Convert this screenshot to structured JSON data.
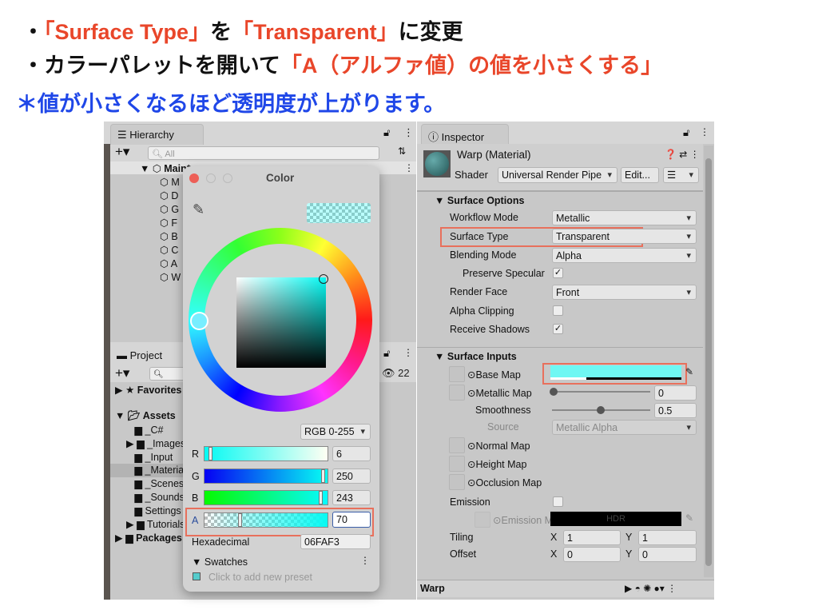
{
  "instructions": {
    "line1": {
      "bullet": "・",
      "p1": "「Surface Type」",
      "p2": "を",
      "p3": "「Transparent」",
      "p4": "に変更"
    },
    "line2": {
      "p1": "・カラーパレットを開いて",
      "p2": "「A（アルファ値）の値を小さくする」"
    },
    "line3": "＊値が小さくなるほど透明度が上がります。"
  },
  "hierarchy": {
    "tab": "Hierarchy",
    "search_placeholder": "All",
    "scene": "Main*",
    "items": [
      "M",
      "D",
      "G",
      "F",
      "B",
      "C",
      "A",
      "W"
    ]
  },
  "project": {
    "tab": "Project",
    "visible_count": "22",
    "favorites": "Favorites",
    "assets": "Assets",
    "folders": [
      "_C#",
      "_Images",
      "_Input",
      "_Materials",
      "_Scenes",
      "_Sounds",
      "Settings",
      "Tutorials"
    ],
    "packages": "Packages"
  },
  "color_picker": {
    "title": "Color",
    "mode": "RGB 0-255",
    "r": {
      "label": "R",
      "value": "6"
    },
    "g": {
      "label": "G",
      "value": "250"
    },
    "b": {
      "label": "B",
      "value": "243"
    },
    "a": {
      "label": "A",
      "value": "70"
    },
    "hex_label": "Hexadecimal",
    "hex": "06FAF3",
    "swatches": "Swatches",
    "add_preset": "Click to add new preset",
    "color": "#06FAF3"
  },
  "inspector": {
    "tab": "Inspector",
    "material": "Warp (Material)",
    "shader_label": "Shader",
    "shader": "Universal Render Pipe",
    "edit": "Edit...",
    "surface_options": "Surface Options",
    "workflow_label": "Workflow Mode",
    "workflow": "Metallic",
    "surface_type_label": "Surface Type",
    "surface_type": "Transparent",
    "blending_label": "Blending Mode",
    "blending": "Alpha",
    "preserve_label": "Preserve Specular",
    "preserve": true,
    "render_face_label": "Render Face",
    "render_face": "Front",
    "alpha_clip_label": "Alpha Clipping",
    "alpha_clip": false,
    "receive_shadows_label": "Receive Shadows",
    "receive_shadows": true,
    "surface_inputs": "Surface Inputs",
    "base_map": "Base Map",
    "metallic_map": "Metallic Map",
    "metallic": "0",
    "smoothness_label": "Smoothness",
    "smoothness": "0.5",
    "source_label": "Source",
    "source": "Metallic Alpha",
    "normal_map": "Normal Map",
    "height_map": "Height Map",
    "occlusion_map": "Occlusion Map",
    "emission_label": "Emission",
    "emission_map": "Emission M",
    "hdr": "HDR",
    "tiling_label": "Tiling",
    "offset_label": "Offset",
    "x": "X",
    "y": "Y",
    "tiling_x": "1",
    "tiling_y": "1",
    "offset_x": "0",
    "offset_y": "0",
    "preview_name": "Warp"
  }
}
